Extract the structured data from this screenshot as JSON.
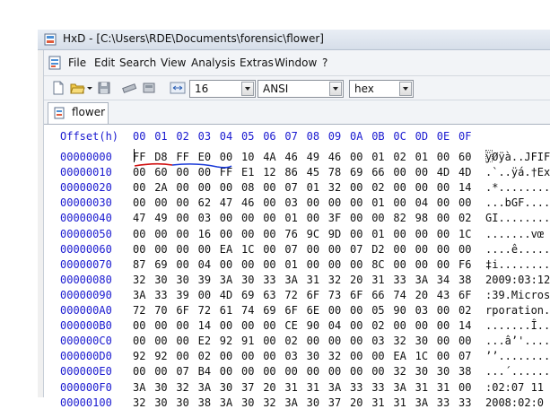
{
  "window": {
    "title": "HxD - [C:\\Users\\RDE\\Documents\\forensic\\flower]"
  },
  "menu": [
    "File",
    "Edit",
    "Search",
    "View",
    "Analysis",
    "Extras",
    "Window",
    "?"
  ],
  "toolbar": {
    "bytes_per_row": "16",
    "charset": "ANSI",
    "offset_base": "hex"
  },
  "tab": {
    "label": "flower"
  },
  "editor": {
    "offset_header": "Offset(h)",
    "columns": [
      "00",
      "01",
      "02",
      "03",
      "04",
      "05",
      "06",
      "07",
      "08",
      "09",
      "0A",
      "0B",
      "0C",
      "0D",
      "0E",
      "0F"
    ],
    "rows": [
      {
        "offset": "00000000",
        "bytes": "FF D8 FF E0 00 10 4A 46 49 46 00 01 02 01 00 60",
        "ascii": "ÿØÿà..JFIF"
      },
      {
        "offset": "00000010",
        "bytes": "00 60 00 00 FF E1 12 86 45 78 69 66 00 00 4D 4D",
        "ascii": ".`..ÿá.†Ex"
      },
      {
        "offset": "00000020",
        "bytes": "00 2A 00 00 00 08 00 07 01 32 00 02 00 00 00 14",
        "ascii": ".*........"
      },
      {
        "offset": "00000030",
        "bytes": "00 00 00 62 47 46 00 03 00 00 00 01 00 04 00 00",
        "ascii": "...bGF...."
      },
      {
        "offset": "00000040",
        "bytes": "47 49 00 03 00 00 00 01 00 3F 00 00 82 98 00 02",
        "ascii": "GI........"
      },
      {
        "offset": "00000050",
        "bytes": "00 00 00 16 00 00 00 76 9C 9D 00 01 00 00 00 1C",
        "ascii": ".......vœ"
      },
      {
        "offset": "00000060",
        "bytes": "00 00 00 00 EA 1C 00 07 00 00 07 D2 00 00 00 00",
        "ascii": "....ê....."
      },
      {
        "offset": "00000070",
        "bytes": "87 69 00 04 00 00 00 01 00 00 00 8C 00 00 00 F6",
        "ascii": "‡i........"
      },
      {
        "offset": "00000080",
        "bytes": "32 30 30 39 3A 30 33 3A 31 32 20 31 33 3A 34 38",
        "ascii": "2009:03:12"
      },
      {
        "offset": "00000090",
        "bytes": "3A 33 39 00 4D 69 63 72 6F 73 6F 66 74 20 43 6F",
        "ascii": ":39.Micros"
      },
      {
        "offset": "000000A0",
        "bytes": "72 70 6F 72 61 74 69 6F 6E 00 00 05 90 03 00 02",
        "ascii": "rporation."
      },
      {
        "offset": "000000B0",
        "bytes": "00 00 00 14 00 00 00 CE 90 04 00 02 00 00 00 14",
        "ascii": ".......Î.."
      },
      {
        "offset": "000000C0",
        "bytes": "00 00 00 E2 92 91 00 02 00 00 00 03 32 30 00 00",
        "ascii": "...â’'...."
      },
      {
        "offset": "000000D0",
        "bytes": "92 92 00 02 00 00 00 03 30 32 00 00 EA 1C 00 07",
        "ascii": "’’........"
      },
      {
        "offset": "000000E0",
        "bytes": "00 00 07 B4 00 00 00 00 00 00 00 00 32 30 30 38",
        "ascii": "...´......"
      },
      {
        "offset": "000000F0",
        "bytes": "3A 30 32 3A 30 37 20 31 31 3A 33 33 3A 31 31 00",
        "ascii": ":02:07 11"
      },
      {
        "offset": "00000100",
        "bytes": "32 30 30 38 3A 30 32 3A 30 37 20 31 31 3A 33 33",
        "ascii": "2008:02:0"
      }
    ]
  },
  "colors": {
    "offset_blue": "#1a1ad0",
    "annotation_red": "#d01010",
    "annotation_blue": "#1a3ad8"
  }
}
